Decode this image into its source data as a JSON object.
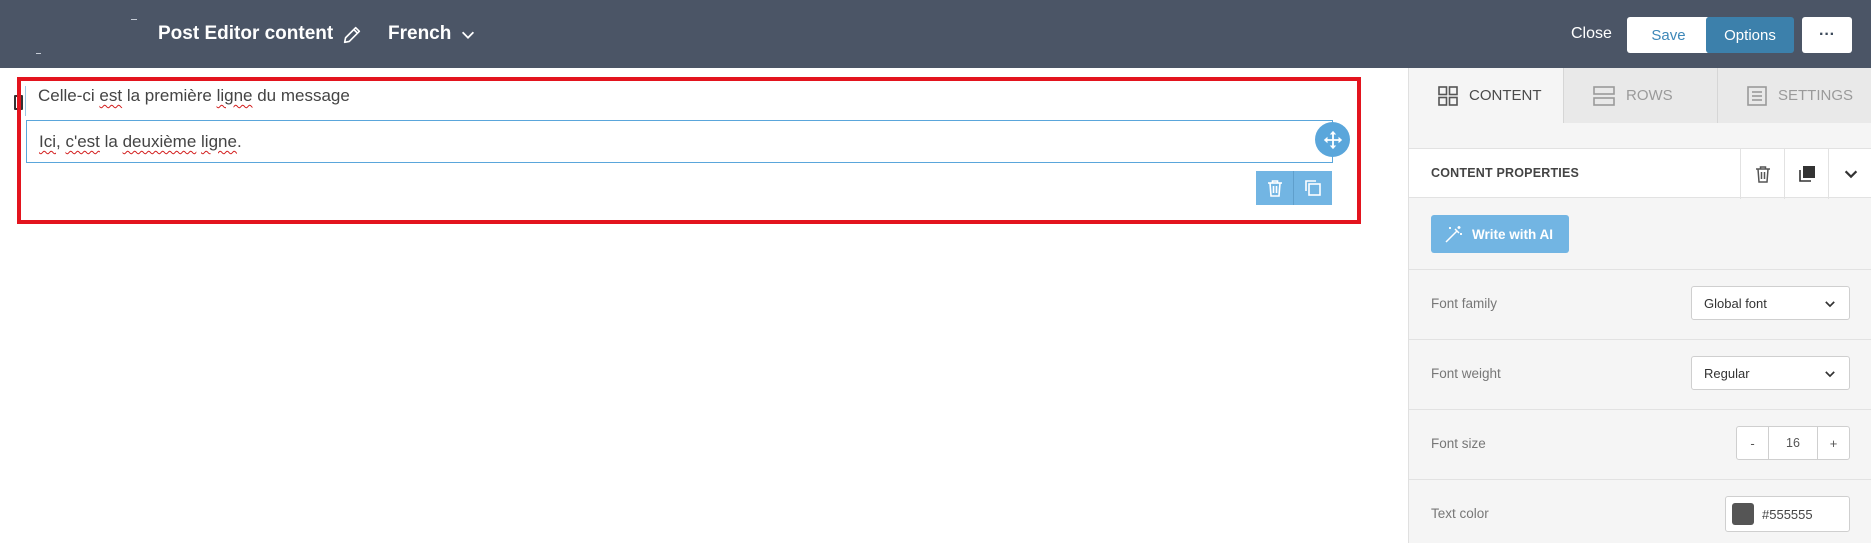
{
  "header": {
    "title": "Post Editor content",
    "language": "French",
    "close_label": "Close",
    "save_label": "Save",
    "options_label": "Options",
    "more_label": "···"
  },
  "canvas": {
    "line1": {
      "before": "Celle-ci ",
      "w1": "est",
      "mid1": " la première ",
      "w2": "ligne",
      "after": " du message"
    },
    "line2": {
      "w1": "Ici",
      "mid1": ", ",
      "w2": "c'est",
      "mid2": " la ",
      "w3": "deuxième",
      "mid3": " ",
      "w4": "ligne",
      "after": "."
    }
  },
  "panel": {
    "tabs": [
      {
        "label": "CONTENT",
        "icon": "grid-icon",
        "active": true
      },
      {
        "label": "ROWS",
        "icon": "rows-icon",
        "active": false
      },
      {
        "label": "SETTINGS",
        "icon": "settings-icon",
        "active": false
      }
    ],
    "content_properties_title": "CONTENT PROPERTIES",
    "write_ai_label": "Write with AI",
    "font_family": {
      "label": "Font family",
      "value": "Global font"
    },
    "font_weight": {
      "label": "Font weight",
      "value": "Regular"
    },
    "font_size": {
      "label": "Font size",
      "minus": "-",
      "value": "16",
      "plus": "+"
    },
    "text_color": {
      "label": "Text color",
      "value": "#555555",
      "swatch": "#555555"
    }
  },
  "colors": {
    "topbar": "#4b5566",
    "accent": "#3c80ab",
    "selection": "#5aa6db",
    "highlight": "#e3141e"
  }
}
